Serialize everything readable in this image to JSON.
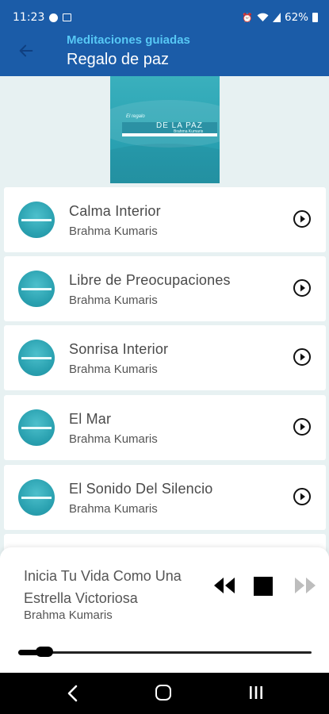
{
  "status_bar": {
    "time": "11:23",
    "battery": "62%"
  },
  "header": {
    "supertitle": "Meditaciones guiadas",
    "title": "Regalo de paz"
  },
  "album_cover": {
    "small_text": "El regalo",
    "big_text": "DE LA PAZ",
    "author_text": "Brahma Kumaris"
  },
  "tracks": [
    {
      "name": "Calma Interior",
      "artist": "Brahma Kumaris"
    },
    {
      "name": "Libre de Preocupaciones",
      "artist": "Brahma Kumaris"
    },
    {
      "name": "Sonrisa Interior",
      "artist": "Brahma Kumaris"
    },
    {
      "name": "El Mar",
      "artist": "Brahma Kumaris"
    },
    {
      "name": "El Sonido Del Silencio",
      "artist": "Brahma Kumaris"
    }
  ],
  "player": {
    "title": "Inicia Tu Vida Como Una Estrella Victoriosa",
    "artist": "Brahma Kumaris",
    "progress": 0.09
  },
  "colors": {
    "header_bg": "#1b5ca8",
    "supertitle": "#57c8f5",
    "page_bg": "#e7f1f2"
  },
  "icons": {
    "back": "arrow-left-icon",
    "play": "play-circle-icon",
    "rewind": "rewind-icon",
    "stop": "stop-icon",
    "forward": "fast-forward-icon"
  }
}
